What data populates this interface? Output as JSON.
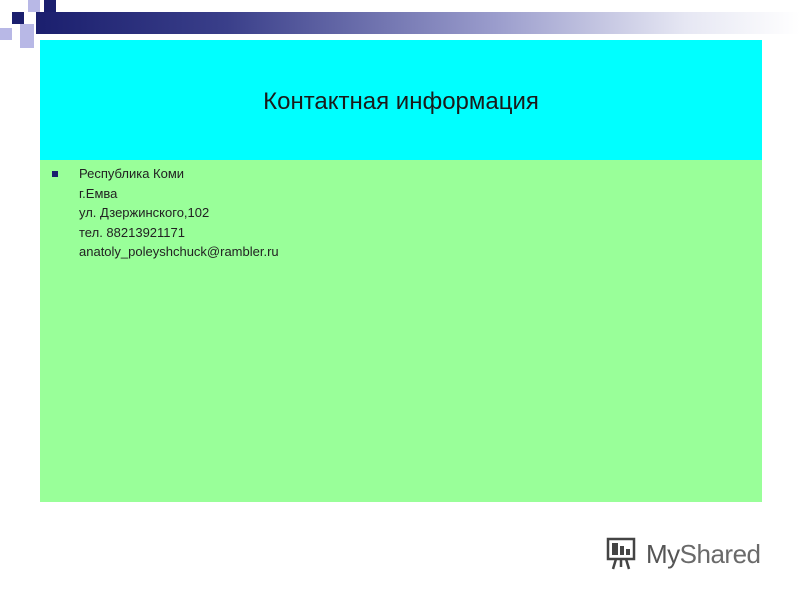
{
  "slide": {
    "title": "Контактная информация",
    "contact_lines": [
      "Республика Коми",
      "г.Емва",
      "ул. Дзержинского,102",
      "тел. 88213921171",
      "anatoly_poleyshchuck@rambler.ru"
    ]
  },
  "logo": {
    "text_prefix": "My",
    "text_suffix": "Shared",
    "icon": "presentation-board-icon"
  },
  "colors": {
    "title_bg": "#00ffff",
    "content_bg": "#99ff99",
    "accent_navy": "#1b1f6e",
    "accent_lavender": "#b8b8e6"
  }
}
